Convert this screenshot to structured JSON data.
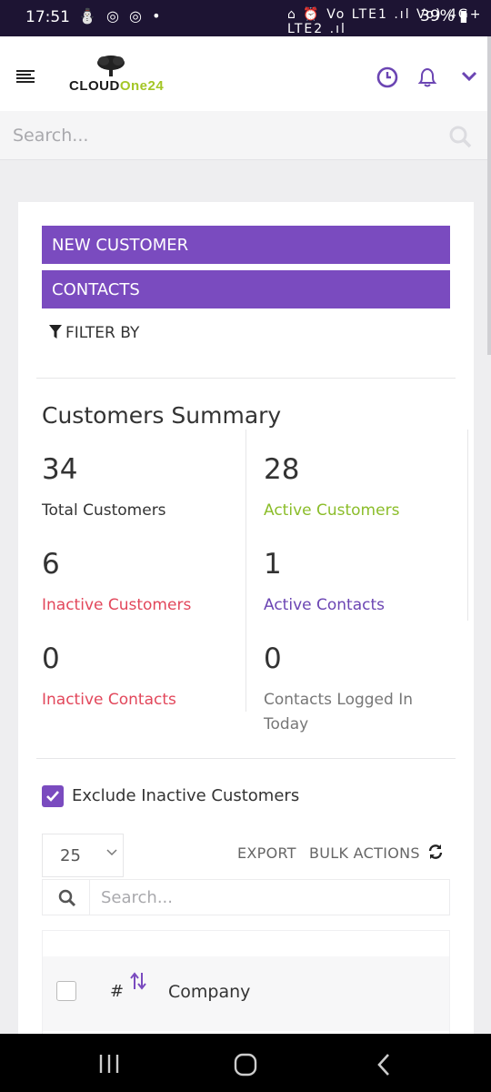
{
  "status_bar": {
    "time": "17:51",
    "left_icons": "⛄ ◎ ◎ •",
    "right_icons": "⌂ ⏰ Vo LTE1 .ıl Vo) 4G+ LTE2 .ıl",
    "battery": "39%"
  },
  "header": {
    "logo_text_1": "CLOUD",
    "logo_text_2": "One24",
    "brand_color": "#7a4bbf",
    "accent_green": "#a4c626"
  },
  "search": {
    "placeholder": "Search..."
  },
  "actions": {
    "new_customer": "NEW CUSTOMER",
    "contacts": "CONTACTS",
    "filter_by": "FILTER BY"
  },
  "summary": {
    "title": "Customers Summary",
    "stats": [
      {
        "value": "34",
        "label": "Total Customers"
      },
      {
        "value": "28",
        "label": "Active Customers"
      },
      {
        "value": "6",
        "label": "Inactive Customers"
      },
      {
        "value": "1",
        "label": "Active Contacts"
      },
      {
        "value": "0",
        "label": "Inactive Contacts"
      },
      {
        "value": "0",
        "label": "Contacts Logged In Today"
      }
    ]
  },
  "table": {
    "exclude_label": "Exclude Inactive Customers",
    "exclude_checked": true,
    "page_size": "25",
    "export": "EXPORT",
    "bulk_actions": "BULK ACTIONS",
    "search_placeholder": "Search...",
    "columns": [
      "#",
      "Company"
    ]
  }
}
